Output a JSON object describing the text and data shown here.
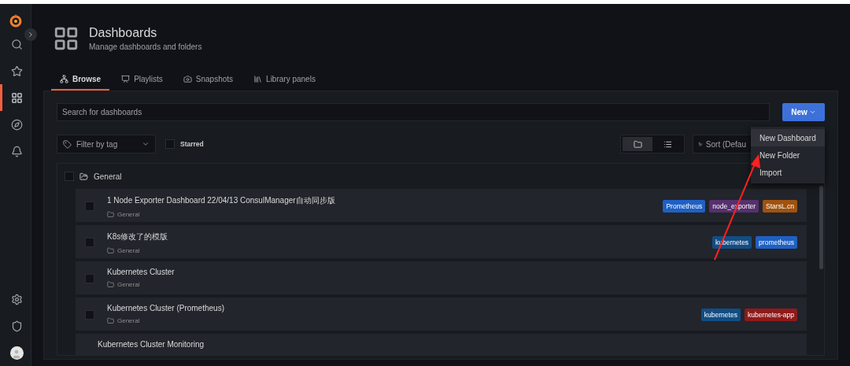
{
  "sidebar": {
    "top": [
      {
        "kind": "search",
        "selected": false
      },
      {
        "kind": "star",
        "selected": false
      },
      {
        "kind": "dashboards",
        "selected": true
      },
      {
        "kind": "explore",
        "selected": false
      },
      {
        "kind": "alerting",
        "selected": false
      }
    ],
    "bottom": [
      {
        "kind": "settings",
        "selected": false
      },
      {
        "kind": "shield",
        "selected": false
      },
      {
        "kind": "avatar",
        "selected": false
      }
    ]
  },
  "header": {
    "title": "Dashboards",
    "subtitle": "Manage dashboards and folders"
  },
  "tabs": [
    {
      "kind": "browse",
      "label": "Browse",
      "selected": true
    },
    {
      "kind": "playlists",
      "label": "Playlists",
      "selected": false
    },
    {
      "kind": "snapshots",
      "label": "Snapshots",
      "selected": false
    },
    {
      "kind": "library",
      "label": "Library panels",
      "selected": false
    }
  ],
  "search": {
    "placeholder": "Search for dashboards"
  },
  "new_button": {
    "label": "New"
  },
  "new_menu": [
    {
      "label": "New Dashboard",
      "selected": true
    },
    {
      "label": "New Folder",
      "selected": false
    },
    {
      "label": "Import",
      "selected": false
    }
  ],
  "filter": {
    "placeholder": "Filter by tag"
  },
  "starred": {
    "label": "Starred",
    "checked": false
  },
  "view_toggle": [
    {
      "kind": "folders",
      "selected": true
    },
    {
      "kind": "list",
      "selected": false
    }
  ],
  "sort": {
    "label": "Sort (Defau"
  },
  "folder": {
    "name": "General",
    "checked": false
  },
  "dashboards": [
    {
      "title": "1 Node Exporter Dashboard 22/04/13 ConsulManager自动同步版",
      "folder": "General",
      "checked": false,
      "tags": [
        {
          "label": "Prometheus",
          "color": "#1f60c4"
        },
        {
          "label": "node_exporter",
          "color": "#56306f"
        },
        {
          "label": "StarsL.cn",
          "color": "#a0520f"
        }
      ]
    },
    {
      "title": "K8s修改了的模版",
      "folder": "General",
      "checked": false,
      "tags": [
        {
          "label": "kubernetes",
          "color": "#124d84"
        },
        {
          "label": "prometheus",
          "color": "#1f60c4"
        }
      ]
    },
    {
      "title": "Kubernetes Cluster",
      "folder": "General",
      "checked": false
    },
    {
      "title": "Kubernetes Cluster (Prometheus)",
      "folder": "General",
      "checked": false,
      "tags": [
        {
          "label": "kubernetes",
          "color": "#124d84"
        },
        {
          "label": "kubernetes-app",
          "color": "#8f1a1a"
        }
      ]
    },
    {
      "title": "Kubernetes Cluster Monitoring"
    }
  ]
}
